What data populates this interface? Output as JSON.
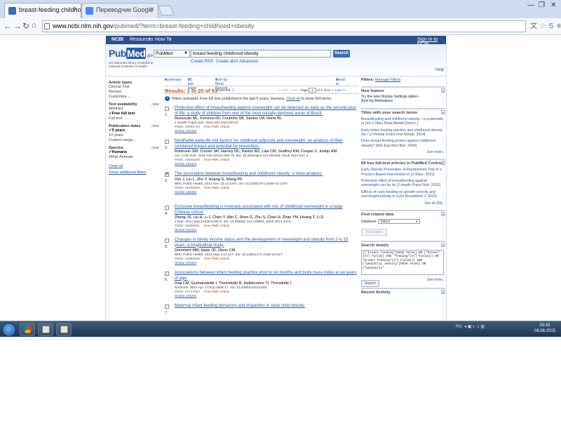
{
  "browser": {
    "tabs": [
      {
        "label": "breast-feeding childhood",
        "active": true
      },
      {
        "label": "Переводчик Google",
        "active": false
      }
    ],
    "url_host": "www.ncbi.nlm.nih.gov",
    "url_path": "/pubmed/?term=breast-feeding+childhood+obesity"
  },
  "ncbi": {
    "logo": "NCBI",
    "resources": "Resources",
    "howto": "How To",
    "signin": "Sign in to NCBI"
  },
  "pubmed": {
    "logo_pub": "Pub",
    "logo_med": "Med",
    "logo_gov": ".gov",
    "tagline": "US National Library of Medicine National Institutes of Health",
    "db": "PubMed",
    "query": "breast-feeding childhood obesity",
    "search_btn": "Search",
    "create_rss": "Create RSS",
    "create_alert": "Create alert",
    "advanced": "Advanced",
    "help": "Help"
  },
  "left_filters": {
    "article_types": "Article types",
    "article_items": [
      "Clinical Trial",
      "Review",
      "Customize ..."
    ],
    "text_availability": "Text availability",
    "clear": "clear",
    "text_items": [
      "Abstract",
      "Free full text",
      "Full text"
    ],
    "pub_dates": "Publication dates",
    "date_items": [
      "5 years",
      "10 years",
      "Custom range..."
    ],
    "species": "Species",
    "species_items": [
      "Humans",
      "Other Animals"
    ],
    "clear_all": "Clear all",
    "show_additional": "Show additional filters"
  },
  "display": {
    "summary": "Summary",
    "per_page": "20 per page",
    "sort": "Sort by Most Recent",
    "send_to": "Send to"
  },
  "results": {
    "count": "Results: 1 to 20 of 53",
    "selected": "Selected: 1",
    "pager_first": "<< First",
    "pager_prev": "< Prev",
    "pager_page": "Page",
    "pager_num": "1",
    "pager_of": "of 3",
    "pager_next": "Next >",
    "pager_last": "Last >>",
    "filter_note": "Filters activated: Free full text, published in the last 5 years, Humans.",
    "filter_clear": "Clear all",
    "filter_show": "to show 369 items."
  },
  "records": [
    {
      "num": "1.",
      "checked": false,
      "title": "Protective effect of breastfeeding against overweight can be detected as early as the second year of life: a study of children from one of the most socially-deprived areas of Brazil.",
      "authors": "Assunção ML, Ferreira HS, Coutinho SB, Santos LM, Horta BL.",
      "cite": "J Health Popul Nutr. 2015 Mar;33(1):85-91.",
      "pmid": "PMID: 25995725",
      "free": "Free PMC Article",
      "similar": "Similar articles"
    },
    {
      "num": "2.",
      "checked": false,
      "title": "Modifiable early-life risk factors for childhood adiposity and overweight: an analysis of their combined impact and potential for prevention.",
      "authors": "Robinson SM, Crozier SR, Harvey NC, Barton BD, Law CM, Godfrey KM, Cooper C, Inskip HM.",
      "cite": "Am J Clin Nutr. 2015 Feb;101(2):368-75. doi: 10.3945/ajcn.114.094268. Epub 2014 Dec 3.",
      "pmid": "PMID: 25646335",
      "free": "Free PMC Article",
      "similar": "Similar articles"
    },
    {
      "num": "3.",
      "checked": true,
      "title": "The association between breastfeeding and childhood obesity: a meta-analysis.",
      "authors": "Yan J, Liu L, Zhu Y, Huang G, Wang PP.",
      "cite": "BMC Public Health. 2014 Dec 13;14:1267. doi: 10.1186/1471-2458-14-1267.",
      "pmid": "PMID: 25495402",
      "free": "Free PMC Article",
      "similar": "Similar articles"
    },
    {
      "num": "4.",
      "checked": false,
      "title": "Exclusive breastfeeding is inversely associated with risk of childhood overweight in a large Chinese cohort.",
      "authors": "Zheng JS, Liu H, Li J, Chen Y, Wei C, Shen G, Zhu S, Chen H, Zhao YM, Huang T, Li D.",
      "cite": "J Nutr. 2014 Sep;144(9):1454-9. doi: 10.3945/jn.114.193664. Epub 2014 Jul 9.",
      "pmid": "PMID: 25008581",
      "free": "Free PMC Article",
      "similar": "Similar articles"
    },
    {
      "num": "5.",
      "checked": false,
      "title": "Changes in family income status and the development of overweight and obesity from 2 to 15 years: a longitudinal study.",
      "authors": "Demment MM, Haas JD, Olson CM.",
      "cite": "BMC Public Health. 2014 May 1;14:417. doi: 10.1186/1471-2458-14-417.",
      "pmid": "PMID: 24886200",
      "free": "Free PMC Article",
      "similar": "Similar articles"
    },
    {
      "num": "6.",
      "checked": false,
      "title": "Associations between infant feeding practice prior to six months and body mass index at six years of age.",
      "authors": "Imai CM, Gunnarsdottir I, Thorisdottir B, Halldorsson TI, Thorsdottir I.",
      "cite": "Nutrients. 2014 Apr 17;6(4):1608-17. doi: 10.3390/nu6041608.",
      "pmid": "PMID: 24747694",
      "free": "Free PMC Article",
      "similar": "Similar articles"
    },
    {
      "num": "7.",
      "checked": false,
      "title": "Maternal infant feeding behaviors and disparities in early child obesity.",
      "authors": "",
      "cite": "",
      "pmid": "",
      "free": "",
      "similar": ""
    }
  ],
  "sidebar": {
    "filters_label": "Filters:",
    "manage_filters": "Manage Filters",
    "new_feature_head": "New feature",
    "new_feature_body": "Try the new Display Settings option -",
    "new_feature_link": "Sort by Relevance",
    "titles_head": "Titles with your search terms",
    "titles_items": [
      {
        "text": "Breastfeeding and childhood obesity—a systematic re",
        "src": "[Int J Obes Relat Metab Disord. ]"
      },
      {
        "text": "Early infant feeding practice and childhood obesity: the r",
        "src": "[J Pediatr Endocrinol Metab. 2014]"
      },
      {
        "text": "Does breast-feeding protect against childhood obesity?",
        "src": "[Adv Exp Med Biol. 2000]"
      }
    ],
    "see_more": "See more...",
    "free_head": "69 free full-text articles in PubMed Central",
    "free_items": [
      {
        "text": "Early Obesity Prevention: A Randomized Trial of a Practice-Based Intervention in",
        "src": "[J Obes. 2015]"
      },
      {
        "text": "Protective effect of breastfeeding against overweight can be de",
        "src": "[J Health Popul Nutr. 2015]"
      },
      {
        "text": "Effects of early feeding on growth velocity and overweight/obesity in a",
        "src": "[Int Breastfeed J. 2015]"
      }
    ],
    "see_all": "See all (69)...",
    "related_head": "Find related data",
    "database_label": "Database:",
    "database_value": "Select",
    "find_items": "Find items",
    "details_head": "Search details",
    "details_text": "((\"breast feeding\"[MeSH Terms] OR (\"breast\"[All Fields] AND \"feeding\"[All Fields]) OR \"breast feeding\"[All Fields]) AND (\"pediatric obesity\"[MeSH Terms] OR (\"pediatric\"",
    "search_btn": "Search",
    "recent_head": "Recent Activity"
  },
  "taskbar": {
    "lang": "RU",
    "time": "20:42",
    "date": "08.06.2015"
  },
  "colors": {
    "ncbi_bar": "#2e4e89",
    "link": "#2a5c9f",
    "results_count": "#c0561e",
    "free_article": "#9c3b10"
  }
}
